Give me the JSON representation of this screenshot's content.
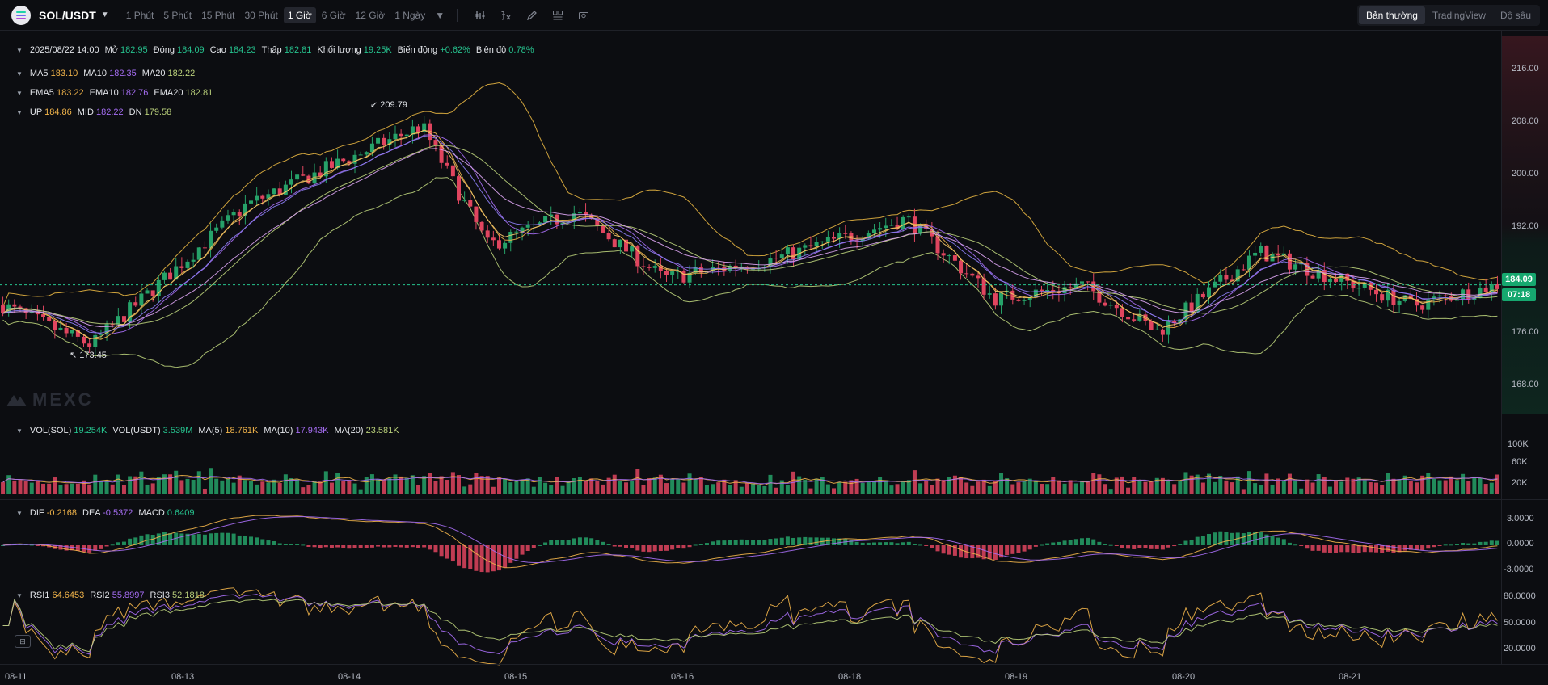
{
  "toolbar": {
    "pair": "SOL/USDT",
    "intervals": [
      "1 Phút",
      "5 Phút",
      "15 Phút",
      "30 Phút",
      "1 Giờ",
      "6 Giờ",
      "12 Giờ",
      "1 Ngày"
    ],
    "active_interval": "1 Giờ",
    "tools": [
      "indicator-icon",
      "formula-icon",
      "draw-icon",
      "layout-icon",
      "camera-icon"
    ],
    "modes": [
      "Bản thường",
      "TradingView",
      "Độ sâu"
    ],
    "active_mode": "Bản thường"
  },
  "ohlc_legend": {
    "datetime": "2025/08/22 14:00",
    "open_label": "Mở",
    "open": "182.95",
    "close_label": "Đóng",
    "close": "184.09",
    "high_label": "Cao",
    "high": "184.23",
    "low_label": "Thấp",
    "low": "182.81",
    "volume_label": "Khối lượng",
    "volume": "19.25K",
    "change_label": "Biến động",
    "change": "+0.62%",
    "amplitude_label": "Biên độ",
    "amplitude": "0.78%"
  },
  "ma_legend": {
    "ma5": "183.10",
    "ma10": "182.35",
    "ma20": "182.22"
  },
  "ema_legend": {
    "ema5": "183.22",
    "ema10": "182.76",
    "ema20": "182.81"
  },
  "boll_legend": {
    "up": "184.86",
    "mid": "182.22",
    "dn": "179.58"
  },
  "vol_legend": {
    "vol_sol": "19.254K",
    "vol_usdt": "3.539M",
    "ma5": "18.761K",
    "ma10": "17.943K",
    "ma20": "23.581K"
  },
  "macd_legend": {
    "dif": "-0.2168",
    "dea": "-0.5372",
    "macd": "0.6409"
  },
  "rsi_legend": {
    "rsi1": "64.6453",
    "rsi2": "55.8997",
    "rsi3": "52.1818"
  },
  "price_axis": [
    "216.00",
    "208.00",
    "200.00",
    "192.00",
    "176.00",
    "168.00"
  ],
  "volume_axis": [
    "100K",
    "60K",
    "20K"
  ],
  "macd_axis": [
    "3.0000",
    "0.0000",
    "-3.0000"
  ],
  "rsi_axis": [
    "80.0000",
    "50.0000",
    "20.0000"
  ],
  "x_axis": [
    "08-11",
    "08-13",
    "08-14",
    "08-15",
    "08-16",
    "08-18",
    "08-19",
    "08-20",
    "08-21"
  ],
  "last_price": "184.09",
  "countdown": "07:18",
  "high_marker": "209.79",
  "low_marker": "173.45",
  "watermark": "MEXC",
  "colors": {
    "up": "#26a269",
    "down": "#e0455f",
    "accent": "#16a86f"
  },
  "chart_data": {
    "type": "candlestick",
    "interval": "1 Giờ",
    "ylim": [
      165,
      222
    ],
    "series_close_keypoints": [
      {
        "x": "08-11",
        "y": 181
      },
      {
        "x": "08-12",
        "y": 175
      },
      {
        "x": "08-13",
        "y": 196
      },
      {
        "x": "08-14",
        "y": 208
      },
      {
        "x": "08-14",
        "y": 190
      },
      {
        "x": "08-15",
        "y": 195
      },
      {
        "x": "08-15",
        "y": 185
      },
      {
        "x": "08-16",
        "y": 188
      },
      {
        "x": "08-18",
        "y": 194
      },
      {
        "x": "08-18",
        "y": 182
      },
      {
        "x": "08-19",
        "y": 184
      },
      {
        "x": "08-19",
        "y": 177
      },
      {
        "x": "08-20",
        "y": 189
      },
      {
        "x": "08-21",
        "y": 181
      },
      {
        "x": "08-22",
        "y": 184.09
      }
    ]
  }
}
